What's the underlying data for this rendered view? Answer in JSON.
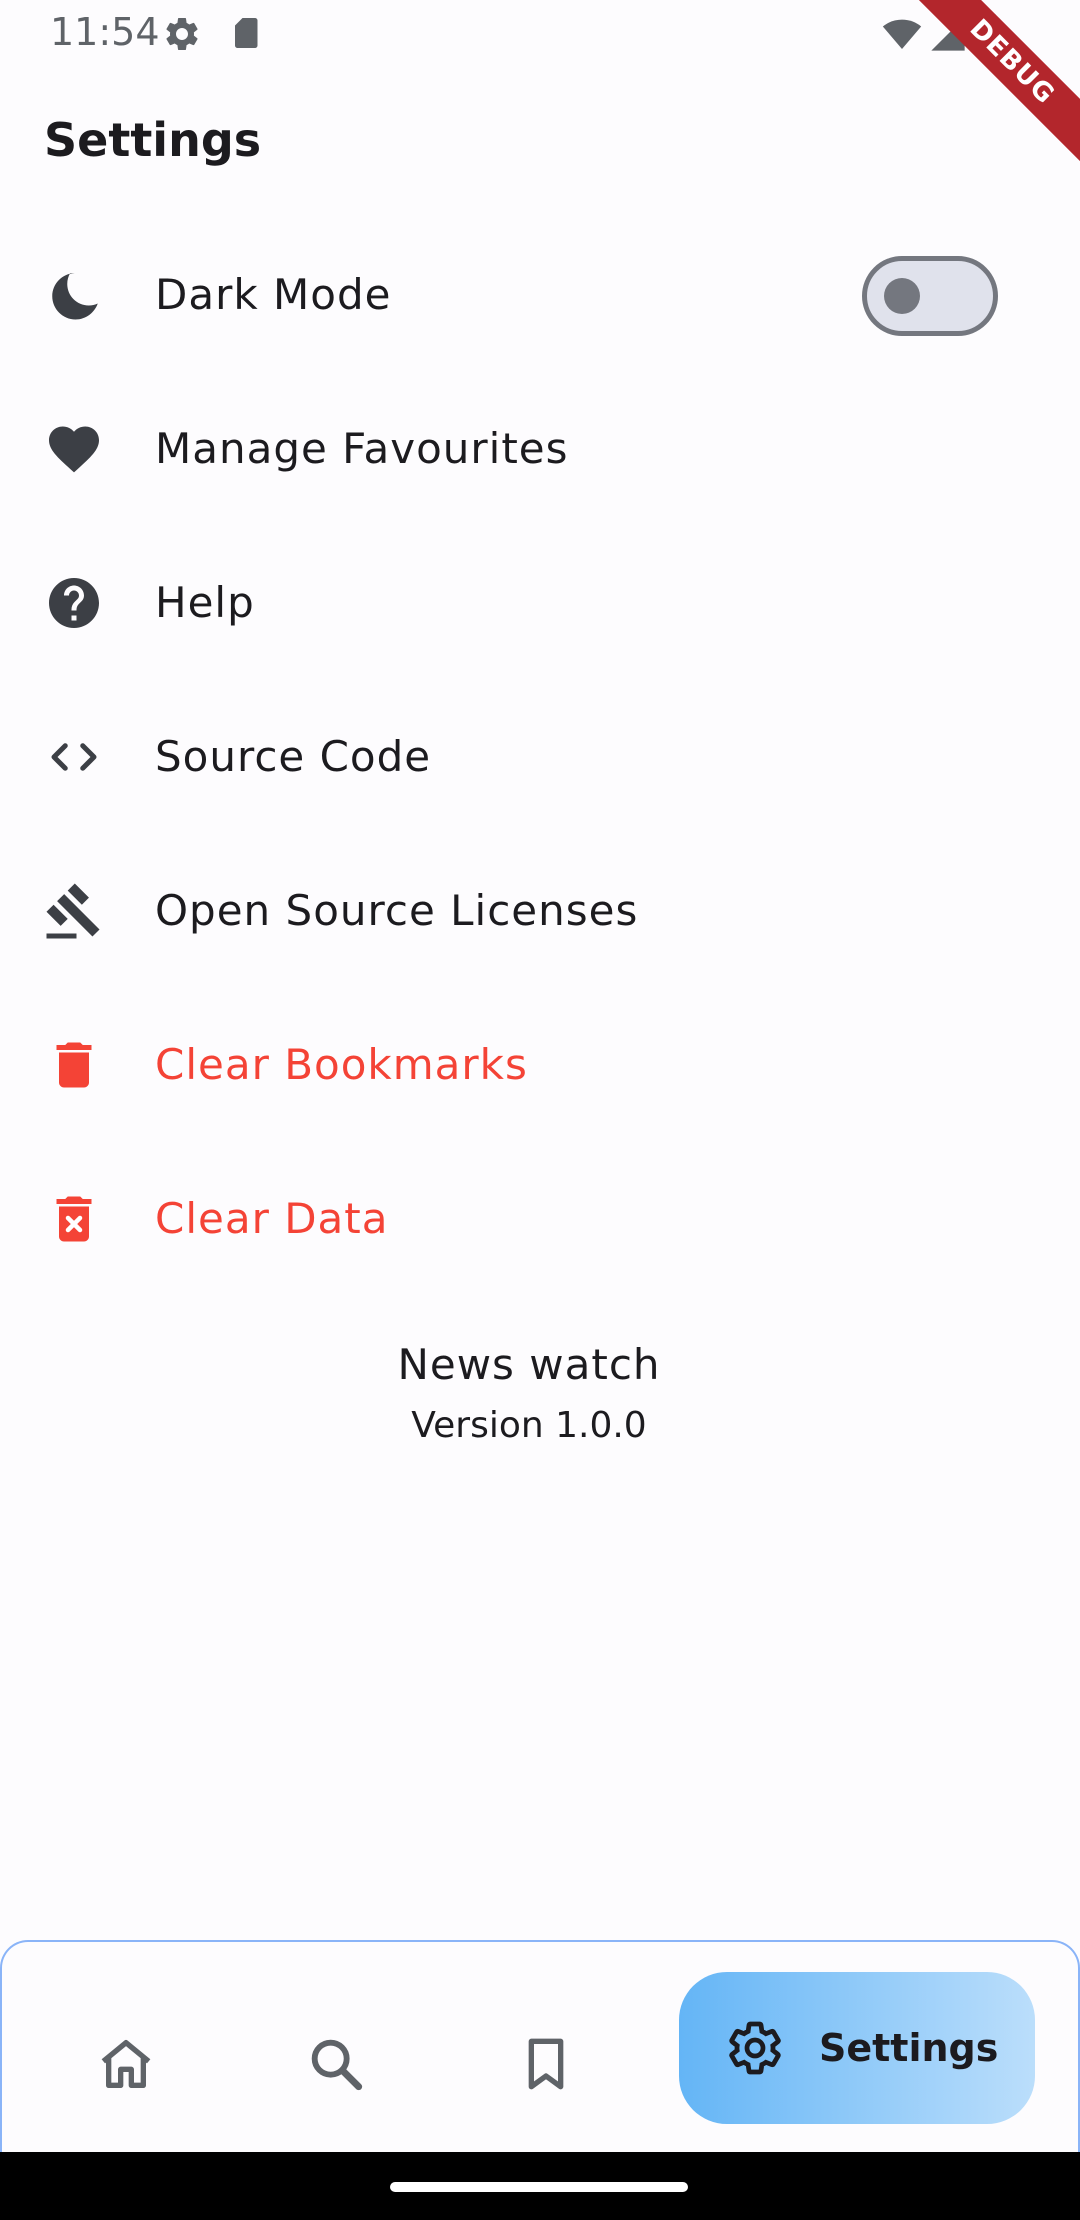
{
  "status_bar": {
    "time": "11:54"
  },
  "debug_banner": "DEBUG",
  "header": {
    "title": "Settings"
  },
  "settings": {
    "items": [
      {
        "label": "Dark Mode",
        "icon": "moon-icon",
        "toggle": {
          "on": false
        }
      },
      {
        "label": "Manage Favourites",
        "icon": "heart-icon"
      },
      {
        "label": "Help",
        "icon": "help-circle-icon"
      },
      {
        "label": "Source Code",
        "icon": "code-icon"
      },
      {
        "label": "Open Source Licenses",
        "icon": "gavel-icon"
      },
      {
        "label": "Clear Bookmarks",
        "icon": "trash-icon",
        "color": "#f44336"
      },
      {
        "label": "Clear Data",
        "icon": "trash-x-icon",
        "color": "#f44336"
      }
    ]
  },
  "app_info": {
    "name": "News watch",
    "version": "Version 1.0.0"
  },
  "bottom_nav": {
    "items": [
      {
        "icon": "home-icon"
      },
      {
        "icon": "search-icon"
      },
      {
        "icon": "bookmark-icon"
      },
      {
        "icon": "gear-icon",
        "label": "Settings",
        "active": true
      }
    ]
  },
  "colors": {
    "background": "#fdfcfe",
    "danger": "#f44336",
    "icon": "#3c3f45",
    "nav_active_start": "#64b5f6",
    "nav_active_end": "#bbdefb"
  }
}
